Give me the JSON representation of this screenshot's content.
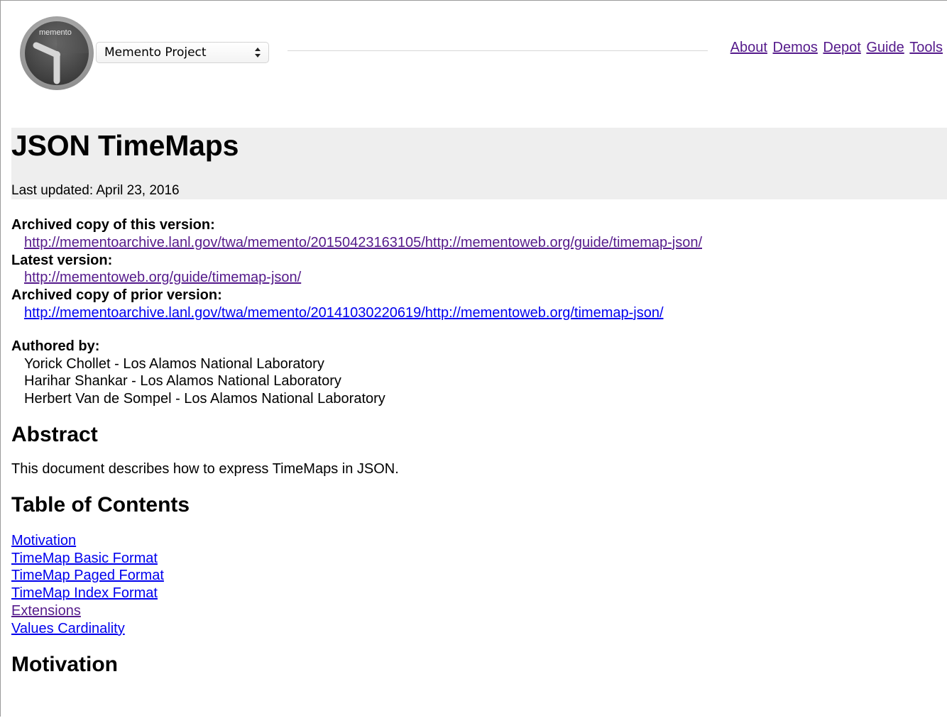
{
  "header": {
    "logo_text": "memento",
    "project_select": {
      "selected": "Memento Project"
    },
    "nav": [
      {
        "label": "About"
      },
      {
        "label": "Demos"
      },
      {
        "label": "Depot"
      },
      {
        "label": "Guide"
      },
      {
        "label": "Tools"
      }
    ]
  },
  "title_block": {
    "title": "JSON TimeMaps",
    "last_updated": "Last updated: April 23, 2016"
  },
  "versions": {
    "archived_label": "Archived copy of this version:",
    "archived_url": "http://mementoarchive.lanl.gov/twa/memento/20150423163105/http://mementoweb.org/guide/timemap-json/",
    "latest_label": "Latest version:",
    "latest_url": "http://mementoweb.org/guide/timemap-json/",
    "prior_label": "Archived copy of prior version:",
    "prior_url": "http://mementoarchive.lanl.gov/twa/memento/20141030220619/http://mementoweb.org/timemap-json/"
  },
  "authors": {
    "label": "Authored by:",
    "list": [
      "Yorick Chollet - Los Alamos National Laboratory",
      "Harihar Shankar - Los Alamos National Laboratory",
      "Herbert Van de Sompel - Los Alamos National Laboratory"
    ]
  },
  "abstract": {
    "heading": "Abstract",
    "text": "This document describes how to express TimeMaps in JSON."
  },
  "toc": {
    "heading": "Table of Contents",
    "items": [
      {
        "label": "Motivation"
      },
      {
        "label": "TimeMap Basic Format"
      },
      {
        "label": "TimeMap Paged Format"
      },
      {
        "label": "TimeMap Index Format"
      },
      {
        "label": "Extensions"
      },
      {
        "label": "Values Cardinality"
      }
    ]
  },
  "motivation": {
    "heading": "Motivation"
  },
  "colors": {
    "link": "#0000ee",
    "visited": "#551a8b",
    "title_bg": "#eeeeee"
  }
}
